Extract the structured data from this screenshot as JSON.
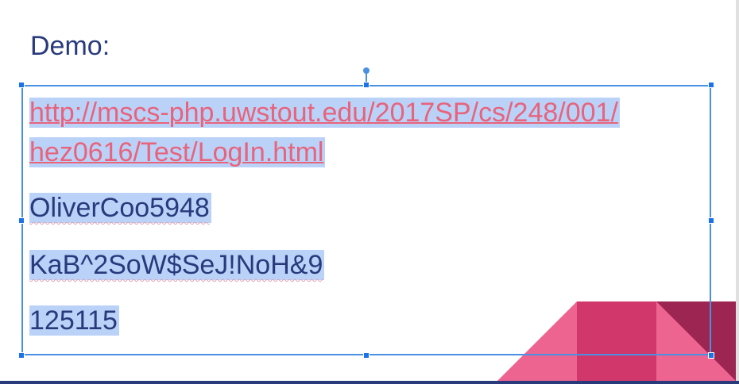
{
  "slide": {
    "title": "Demo:",
    "lines": {
      "url_part1": "http://mscs-php.uwstout.edu/2017SP/cs/248/001/",
      "url_part2": "hez0616/Test/LogIn.html",
      "username": "OliverCoo5948",
      "password": "KaB^2SoW$SeJ!NoH&9",
      "code": "125115"
    }
  },
  "colors": {
    "title_text": "#283a7c",
    "link_text": "#e8637c",
    "selection_highlight": "#bad2f8",
    "selection_border": "#4a90e2",
    "decoration_pink": "#ee6490",
    "decoration_crimson": "#d1376a",
    "decoration_maroon": "#9c2552"
  }
}
